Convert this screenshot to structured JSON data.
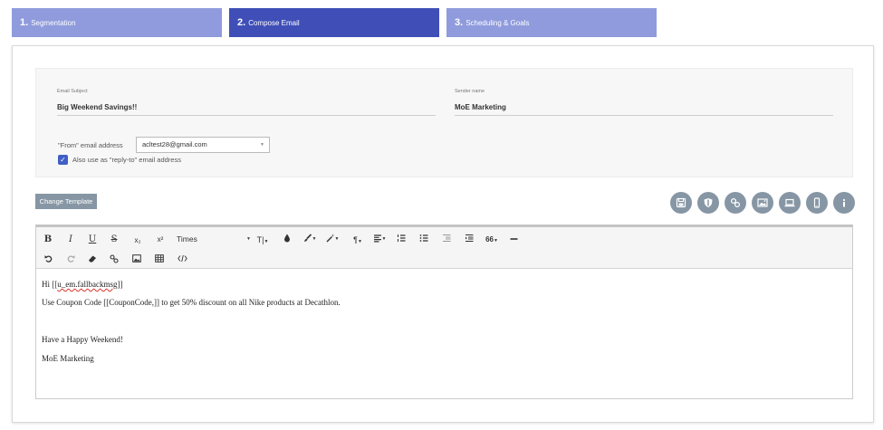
{
  "steps": [
    {
      "num": "1.",
      "label": "Segmentation",
      "active": false
    },
    {
      "num": "2.",
      "label": "Compose Email",
      "active": true
    },
    {
      "num": "3.",
      "label": "Scheduling & Goals",
      "active": false
    }
  ],
  "form": {
    "subject_label": "Email Subject",
    "subject_value": "Big Weekend Savings!!",
    "sender_label": "Sender name",
    "sender_value": "MoE Marketing",
    "from_label": "\"From\" email address",
    "from_value": "acltest28@gmail.com",
    "reply_to_label": "Also use as \"reply-to\" email address",
    "reply_to_checked": true
  },
  "change_template_label": "Change Template",
  "toolbar": {
    "bold": "B",
    "italic": "I",
    "underline": "U",
    "strike": "S",
    "subscript": "x₂",
    "superscript": "x²",
    "font": "Times",
    "font_size": "T|",
    "paragraph": "¶",
    "quote": "66"
  },
  "content": {
    "line1_prefix": "Hi [[",
    "line1_var": "u_em.fallbackmsg",
    "line1_suffix": "]]",
    "line2": "Use Coupon Code [[CouponCode,]] to get 50% discount on all Nike products at Decathlon.",
    "line3": "Have a Happy Weekend!",
    "line4": "MoE Marketing"
  },
  "icons": {
    "tools": [
      "save-icon",
      "shield-icon",
      "link-icon",
      "image-icon",
      "laptop-icon",
      "mobile-icon",
      "info-icon"
    ]
  },
  "colors": {
    "step_active": "#3f4fb7",
    "step_inactive": "#8f9bdc",
    "tool_button": "#8696a4",
    "checkbox": "#3f5fc4"
  }
}
